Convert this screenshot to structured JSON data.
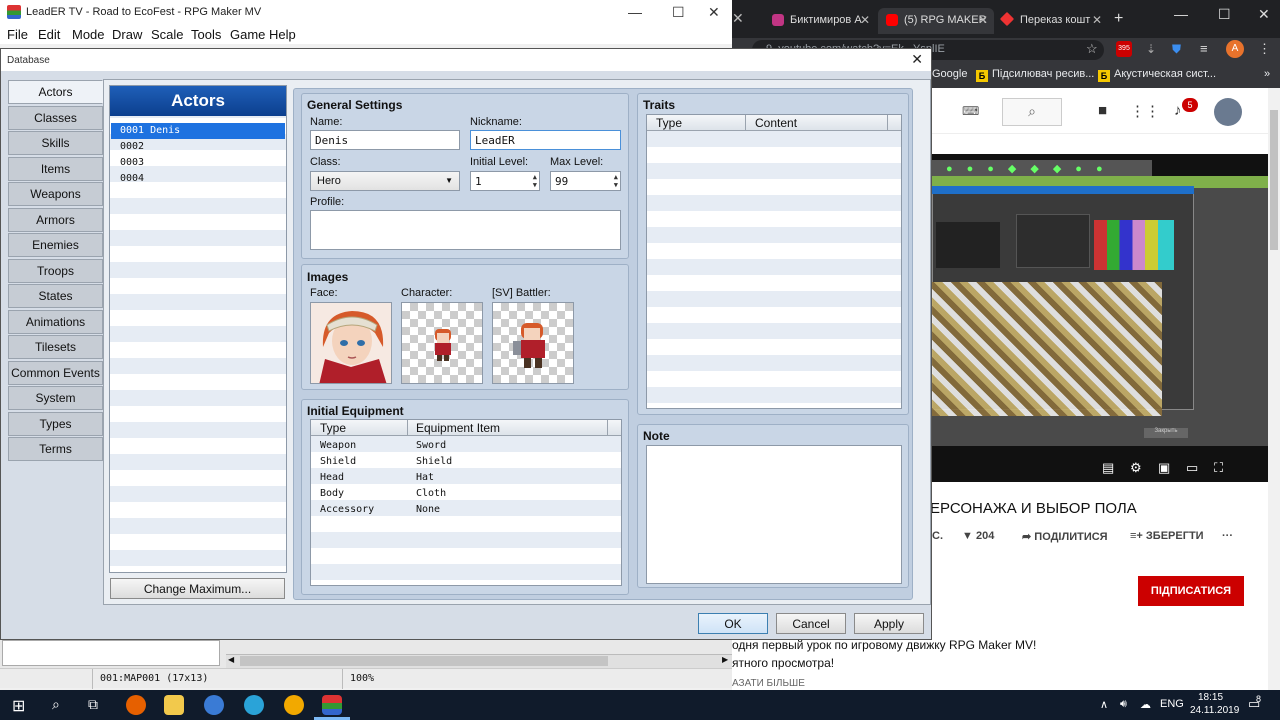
{
  "browser": {
    "tabs": [
      {
        "title": "Биктимиров А",
        "favicon_color": "#c13584"
      },
      {
        "title": "(5) RPG MAKER",
        "favicon_color": "#ff0000"
      },
      {
        "title": "Переказ кошт",
        "favicon_color": "#e33"
      }
    ],
    "omnibox_text": "9. youtube.com/watch?v=Ek...YsplIE",
    "bookmarks": [
      {
        "icon": "Б",
        "label": "Підсилювач ресив..."
      },
      {
        "icon": "Б",
        "label": "Акустическая сист..."
      }
    ],
    "bookmark_left": "Google",
    "notification_count": "5",
    "avatar_letter": "A",
    "extension_badge": "395",
    "video_title": "ЕРСОНАЖА И ВЫБОР ПОЛА",
    "likes": "204",
    "share_label": "ПОДІЛИТИСЯ",
    "save_label": "ЗБЕРЕГТИ",
    "meta_left": "С.",
    "subscribe_label": "ПІДПИСАТИСЯ",
    "desc_line1": "одня первый урок по игровому движку RPG Maker MV!",
    "desc_line2": "ятного просмотра!",
    "show_more": "АЗАТИ БІЛЬШЕ",
    "video_button_label": "Закрыть"
  },
  "rpg": {
    "title": "LeadER TV - Road to EcoFest - RPG Maker MV",
    "menu": [
      "File",
      "Edit",
      "Mode",
      "Draw",
      "Scale",
      "Tools",
      "Game",
      "Help"
    ],
    "status_map": "001:MAP001 (17x13)",
    "status_zoom": "100%"
  },
  "database": {
    "title": "Database",
    "categories": [
      "Actors",
      "Classes",
      "Skills",
      "Items",
      "Weapons",
      "Armors",
      "Enemies",
      "Troops",
      "States",
      "Animations",
      "Tilesets",
      "Common Events",
      "System",
      "Types",
      "Terms"
    ],
    "active_category": "Actors",
    "list_header": "Actors",
    "actors": [
      "0001 Denis",
      "0002",
      "0003",
      "0004"
    ],
    "change_max_label": "Change Maximum...",
    "general": {
      "heading": "General Settings",
      "name_label": "Name:",
      "name_value": "Denis",
      "nickname_label": "Nickname:",
      "nickname_value": "LeadER",
      "class_label": "Class:",
      "class_value": "Hero",
      "initial_level_label": "Initial Level:",
      "initial_level_value": "1",
      "max_level_label": "Max Level:",
      "max_level_value": "99",
      "profile_label": "Profile:",
      "profile_value": ""
    },
    "images": {
      "heading": "Images",
      "face_label": "Face:",
      "character_label": "Character:",
      "battler_label": "[SV] Battler:"
    },
    "equipment": {
      "heading": "Initial Equipment",
      "col_type": "Type",
      "col_item": "Equipment Item",
      "rows": [
        {
          "type": "Weapon",
          "item": "Sword"
        },
        {
          "type": "Shield",
          "item": "Shield"
        },
        {
          "type": "Head",
          "item": "Hat"
        },
        {
          "type": "Body",
          "item": "Cloth"
        },
        {
          "type": "Accessory",
          "item": "None"
        }
      ]
    },
    "traits": {
      "heading": "Traits",
      "col_type": "Type",
      "col_content": "Content"
    },
    "note": {
      "heading": "Note",
      "value": ""
    },
    "buttons": {
      "ok": "OK",
      "cancel": "Cancel",
      "apply": "Apply"
    }
  },
  "taskbar": {
    "lang": "ENG",
    "time": "18:15",
    "date": "24.11.2019",
    "notifications": "8"
  }
}
